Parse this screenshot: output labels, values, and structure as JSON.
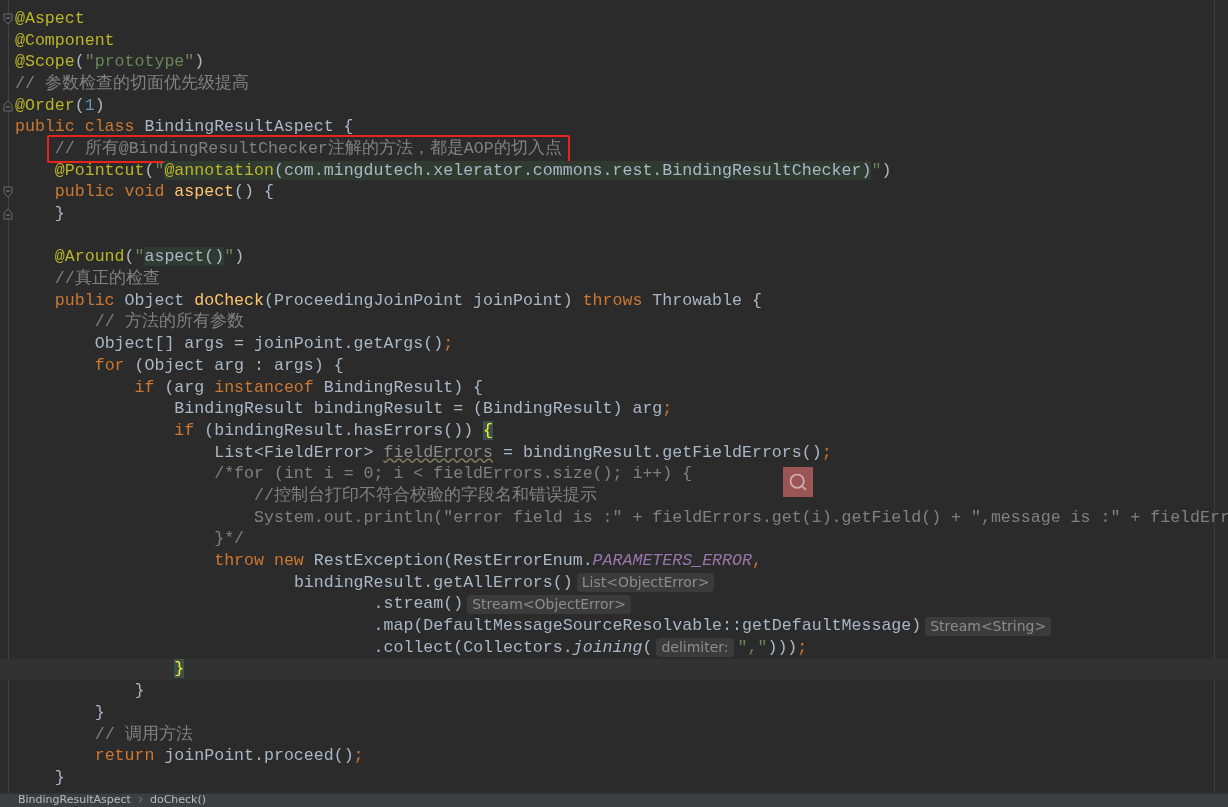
{
  "editor": {
    "lines": [
      {
        "fold": {
          "kind": "open"
        },
        "tokens": [
          {
            "kind": "ann",
            "t": "@Aspect"
          }
        ]
      },
      {
        "tokens": [
          {
            "kind": "ann",
            "t": "@Component"
          }
        ]
      },
      {
        "tokens": [
          {
            "kind": "ann",
            "t": "@Scope"
          },
          {
            "kind": "plain",
            "t": "("
          },
          {
            "kind": "str",
            "t": "\"prototype\""
          },
          {
            "kind": "plain",
            "t": ")"
          }
        ]
      },
      {
        "tokens": [
          {
            "kind": "cmt",
            "t": "// 参数检查的切面优先级提高"
          }
        ]
      },
      {
        "fold": {
          "kind": "close"
        },
        "tokens": [
          {
            "kind": "ann",
            "t": "@Order"
          },
          {
            "kind": "plain",
            "t": "("
          },
          {
            "kind": "num",
            "t": "1"
          },
          {
            "kind": "plain",
            "t": ")"
          }
        ]
      },
      {
        "tokens": [
          {
            "kind": "kw",
            "t": "public class "
          },
          {
            "kind": "plain",
            "t": "BindingResultAspect {"
          }
        ]
      },
      {
        "outlined": true,
        "tokens": [
          {
            "kind": "cmt",
            "t": "    // 所有@BindingResultChecker注解的方法，都是AOP的切入点"
          }
        ]
      },
      {
        "tokens": [
          {
            "kind": "ann",
            "t": "    @Pointcut"
          },
          {
            "kind": "plain",
            "t": "("
          },
          {
            "kind": "str",
            "t": "\""
          },
          {
            "kind": "injann",
            "t": "@annotation"
          },
          {
            "kind": "inj",
            "t": "(com.mingdutech.xelerator.commons.rest.BindingResultChecker)"
          },
          {
            "kind": "str",
            "t": "\""
          },
          {
            "kind": "plain",
            "t": ")"
          }
        ]
      },
      {
        "fold": {
          "kind": "open"
        },
        "tokens": [
          {
            "kind": "kw",
            "t": "    public void "
          },
          {
            "kind": "fn",
            "t": "aspect"
          },
          {
            "kind": "plain",
            "t": "() {"
          }
        ]
      },
      {
        "fold": {
          "kind": "close"
        },
        "tokens": [
          {
            "kind": "plain",
            "t": "    }"
          }
        ]
      },
      {
        "blank_line_above": true,
        "tokens": [
          {
            "kind": "ann",
            "t": "    @Around"
          },
          {
            "kind": "plain",
            "t": "("
          },
          {
            "kind": "str",
            "t": "\""
          },
          {
            "kind": "inj",
            "t": "aspect()"
          },
          {
            "kind": "str",
            "t": "\""
          },
          {
            "kind": "plain",
            "t": ")"
          }
        ]
      },
      {
        "tokens": [
          {
            "kind": "cmt",
            "t": "    //真正的检查"
          }
        ]
      },
      {
        "tokens": [
          {
            "kind": "kw",
            "t": "    public "
          },
          {
            "kind": "plain",
            "t": "Object "
          },
          {
            "kind": "fn",
            "t": "doCheck"
          },
          {
            "kind": "plain",
            "t": "(ProceedingJoinPoint joinPoint) "
          },
          {
            "kind": "kw",
            "t": "throws "
          },
          {
            "kind": "plain",
            "t": "Throwable {"
          }
        ]
      },
      {
        "tokens": [
          {
            "kind": "cmt",
            "t": "        // 方法的所有参数"
          }
        ]
      },
      {
        "tokens": [
          {
            "kind": "plain",
            "t": "        Object[] args = joinPoint.getArgs()"
          },
          {
            "kind": "kw",
            "t": ";"
          }
        ]
      },
      {
        "tokens": [
          {
            "kind": "kw",
            "t": "        for "
          },
          {
            "kind": "plain",
            "t": "(Object arg : args) {"
          }
        ]
      },
      {
        "tokens": [
          {
            "kind": "kw",
            "t": "            if "
          },
          {
            "kind": "plain",
            "t": "(arg "
          },
          {
            "kind": "kw",
            "t": "instanceof "
          },
          {
            "kind": "plain",
            "t": "BindingResult) {"
          }
        ]
      },
      {
        "tokens": [
          {
            "kind": "plain",
            "t": "                BindingResult bindingResult = (BindingResult) arg"
          },
          {
            "kind": "kw",
            "t": ";"
          }
        ]
      },
      {
        "tokens": [
          {
            "kind": "kw",
            "t": "                if "
          },
          {
            "kind": "plain",
            "t": "(bindingResult.hasErrors()) "
          },
          {
            "kind": "brace",
            "t": "{"
          }
        ]
      },
      {
        "tokens": [
          {
            "kind": "plain",
            "t": "                    List<FieldError> "
          },
          {
            "kind": "unused",
            "t": "fieldErrors"
          },
          {
            "kind": "plain",
            "t": " = bindingResult.getFieldErrors()"
          },
          {
            "kind": "kw",
            "t": ";"
          }
        ]
      },
      {
        "tokens": [
          {
            "kind": "cmt",
            "t": "                    /*for (int i = 0; i < fieldErrors.size(); i++) {"
          }
        ]
      },
      {
        "tokens": [
          {
            "kind": "cmt",
            "t": "                        //控制台打印不符合校验的字段名和错误提示"
          }
        ]
      },
      {
        "tokens": [
          {
            "kind": "cmt",
            "t": "                        System.out.println(\"error field is :\" + fieldErrors.get(i).getField() + \",message is :\" + fieldErr"
          }
        ]
      },
      {
        "tokens": [
          {
            "kind": "cmt",
            "t": "                    }*/"
          }
        ]
      },
      {
        "tokens": [
          {
            "kind": "kw",
            "t": "                    throw new "
          },
          {
            "kind": "plain",
            "t": "RestException(RestErrorEnum."
          },
          {
            "kind": "static",
            "t": "PARAMETERS_ERROR"
          },
          {
            "kind": "kw",
            "t": ","
          }
        ]
      },
      {
        "tokens": [
          {
            "kind": "plain",
            "t": "                            bindingResult.getAllErrors()"
          },
          {
            "kind": "hint",
            "t": "List<ObjectError>"
          }
        ]
      },
      {
        "tokens": [
          {
            "kind": "plain",
            "t": "                                    .stream()"
          },
          {
            "kind": "hint",
            "t": "Stream<ObjectError>"
          }
        ]
      },
      {
        "tokens": [
          {
            "kind": "plain",
            "t": "                                    .map(DefaultMessageSourceResolvable::getDefaultMessage)"
          },
          {
            "kind": "hint",
            "t": "Stream<String>"
          }
        ]
      },
      {
        "tokens": [
          {
            "kind": "plain",
            "t": "                                    .collect(Collectors."
          },
          {
            "kind": "italic",
            "t": "joining"
          },
          {
            "kind": "plain",
            "t": "("
          },
          {
            "kind": "hint",
            "t": "delimiter:"
          },
          {
            "kind": "str",
            "t": "\",\""
          },
          {
            "kind": "plain",
            "t": ")))"
          },
          {
            "kind": "kw",
            "t": ";"
          }
        ]
      },
      {
        "current": true,
        "tokens": [
          {
            "kind": "brace",
            "t": "                }"
          }
        ]
      },
      {
        "tokens": [
          {
            "kind": "plain",
            "t": "            }"
          }
        ]
      },
      {
        "tokens": [
          {
            "kind": "plain",
            "t": "        }"
          }
        ]
      },
      {
        "tokens": [
          {
            "kind": "cmt",
            "t": "        // 调用方法"
          }
        ]
      },
      {
        "tokens": [
          {
            "kind": "kw",
            "t": "        return "
          },
          {
            "kind": "plain",
            "t": "joinPoint.proceed()"
          },
          {
            "kind": "kw",
            "t": ";"
          }
        ]
      },
      {
        "tokens": [
          {
            "kind": "plain",
            "t": "    }"
          }
        ]
      }
    ]
  },
  "breadcrumbs": [
    "BindingResultAspect",
    "doCheck()"
  ]
}
